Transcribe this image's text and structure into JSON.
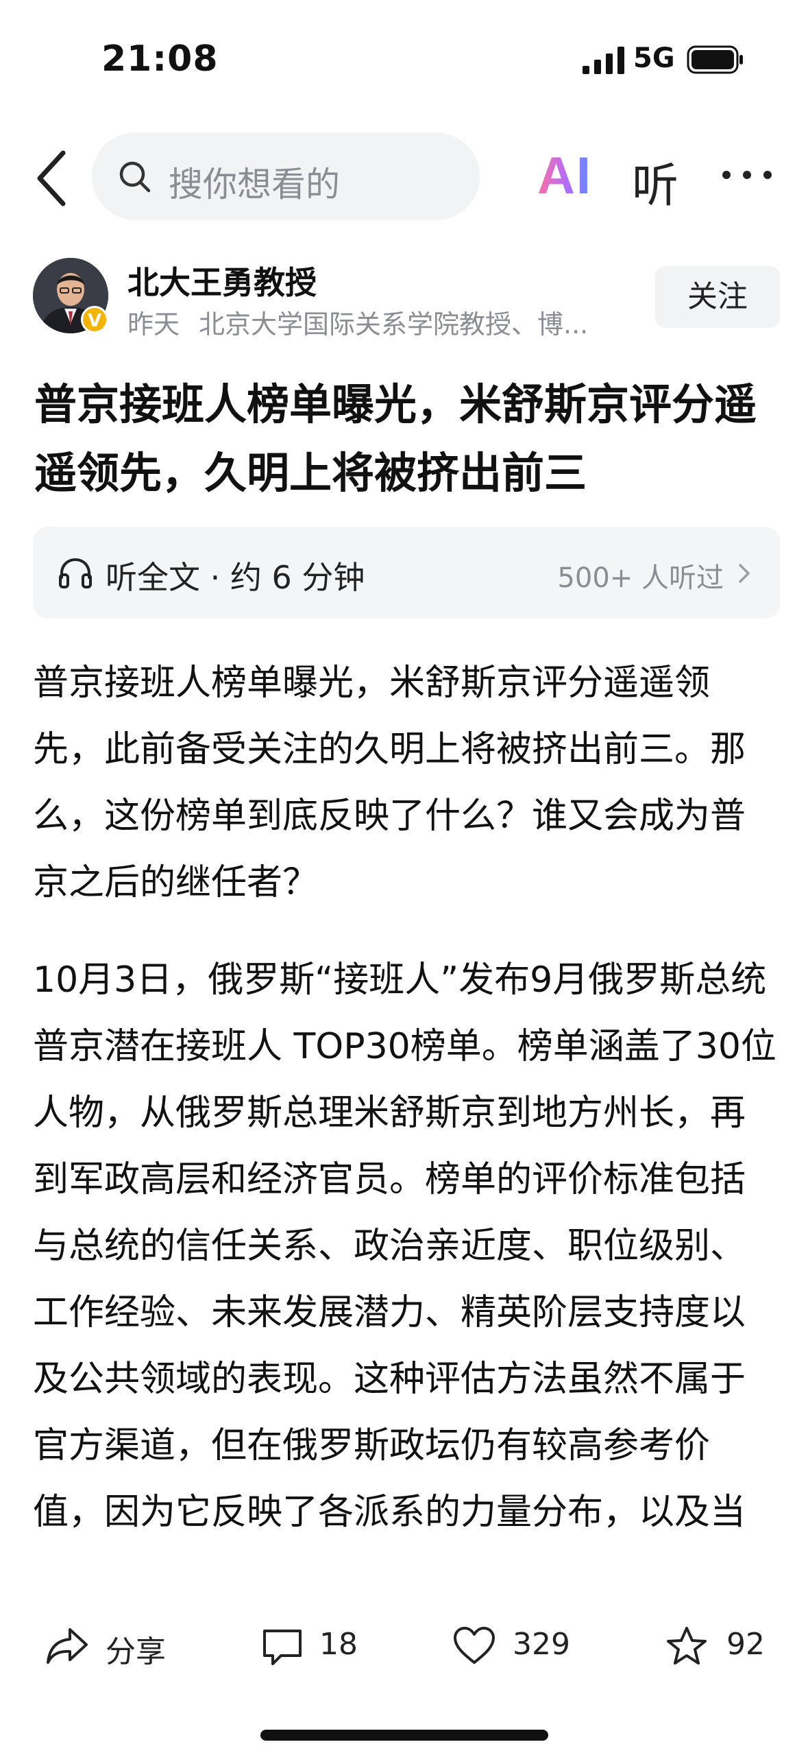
{
  "status_bar": {
    "time": "21:08",
    "network": "5G"
  },
  "nav": {
    "search_placeholder": "搜你想看的",
    "ai_label": "AI",
    "listen_label": "听"
  },
  "author": {
    "name": "北大王勇教授",
    "time": "昨天",
    "bio": "北京大学国际关系学院教授、博...",
    "verified_mark": "V",
    "follow_label": "关注"
  },
  "article": {
    "title": "普京接班人榜单曝光，米舒斯京评分遥遥领先，久明上将被挤出前三",
    "listen_bar": {
      "label": "听全文 · 约 6 分钟",
      "listeners": "500+ 人听过"
    },
    "paragraphs": [
      "普京接班人榜单曝光，米舒斯京评分遥遥领先，此前备受关注的久明上将被挤出前三。那么，这份榜单到底反映了什么？谁又会成为普京之后的继任者？",
      "10月3日，俄罗斯“接班人”发布9月俄罗斯总统普京潜在接班人 TOP30榜单。榜单涵盖了30位人物，从俄罗斯总理米舒斯京到地方州长，再到军政高层和经济官员。榜单的评价标准包括与总统的信任关系、政治亲近度、职位级别、工作经验、未来发展潜力、精英阶层支持度以及公共领域的表现。这种评估方法虽然不属于官方渠道，但在俄罗斯政坛仍有较高参考价值，因为它反映了各派系的力量分布，以及当"
    ]
  },
  "actions": {
    "share_label": "分享",
    "comments": "18",
    "likes": "329",
    "favorites": "92"
  },
  "colors": {
    "accent_gradient": [
      "#ff6fa2",
      "#b06cff",
      "#5f8bff"
    ],
    "verified": "#f5b400",
    "muted_text": "#8a8d93",
    "panel_bg": "#f2f3f5"
  }
}
